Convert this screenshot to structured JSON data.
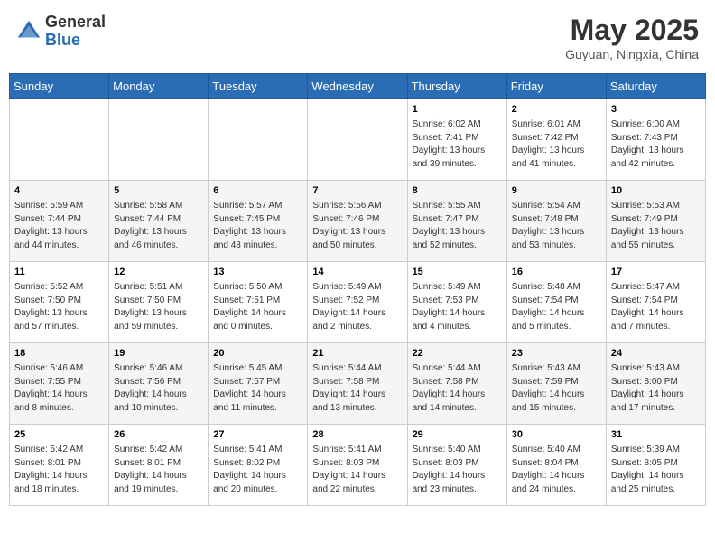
{
  "header": {
    "logo_general": "General",
    "logo_blue": "Blue",
    "title": "May 2025",
    "location": "Guyuan, Ningxia, China"
  },
  "days_of_week": [
    "Sunday",
    "Monday",
    "Tuesday",
    "Wednesday",
    "Thursday",
    "Friday",
    "Saturday"
  ],
  "weeks": [
    {
      "row": 1,
      "days": [
        {
          "num": "",
          "info": ""
        },
        {
          "num": "",
          "info": ""
        },
        {
          "num": "",
          "info": ""
        },
        {
          "num": "",
          "info": ""
        },
        {
          "num": "1",
          "info": "Sunrise: 6:02 AM\nSunset: 7:41 PM\nDaylight: 13 hours and 39 minutes."
        },
        {
          "num": "2",
          "info": "Sunrise: 6:01 AM\nSunset: 7:42 PM\nDaylight: 13 hours and 41 minutes."
        },
        {
          "num": "3",
          "info": "Sunrise: 6:00 AM\nSunset: 7:43 PM\nDaylight: 13 hours and 42 minutes."
        }
      ]
    },
    {
      "row": 2,
      "days": [
        {
          "num": "4",
          "info": "Sunrise: 5:59 AM\nSunset: 7:44 PM\nDaylight: 13 hours and 44 minutes."
        },
        {
          "num": "5",
          "info": "Sunrise: 5:58 AM\nSunset: 7:44 PM\nDaylight: 13 hours and 46 minutes."
        },
        {
          "num": "6",
          "info": "Sunrise: 5:57 AM\nSunset: 7:45 PM\nDaylight: 13 hours and 48 minutes."
        },
        {
          "num": "7",
          "info": "Sunrise: 5:56 AM\nSunset: 7:46 PM\nDaylight: 13 hours and 50 minutes."
        },
        {
          "num": "8",
          "info": "Sunrise: 5:55 AM\nSunset: 7:47 PM\nDaylight: 13 hours and 52 minutes."
        },
        {
          "num": "9",
          "info": "Sunrise: 5:54 AM\nSunset: 7:48 PM\nDaylight: 13 hours and 53 minutes."
        },
        {
          "num": "10",
          "info": "Sunrise: 5:53 AM\nSunset: 7:49 PM\nDaylight: 13 hours and 55 minutes."
        }
      ]
    },
    {
      "row": 3,
      "days": [
        {
          "num": "11",
          "info": "Sunrise: 5:52 AM\nSunset: 7:50 PM\nDaylight: 13 hours and 57 minutes."
        },
        {
          "num": "12",
          "info": "Sunrise: 5:51 AM\nSunset: 7:50 PM\nDaylight: 13 hours and 59 minutes."
        },
        {
          "num": "13",
          "info": "Sunrise: 5:50 AM\nSunset: 7:51 PM\nDaylight: 14 hours and 0 minutes."
        },
        {
          "num": "14",
          "info": "Sunrise: 5:49 AM\nSunset: 7:52 PM\nDaylight: 14 hours and 2 minutes."
        },
        {
          "num": "15",
          "info": "Sunrise: 5:49 AM\nSunset: 7:53 PM\nDaylight: 14 hours and 4 minutes."
        },
        {
          "num": "16",
          "info": "Sunrise: 5:48 AM\nSunset: 7:54 PM\nDaylight: 14 hours and 5 minutes."
        },
        {
          "num": "17",
          "info": "Sunrise: 5:47 AM\nSunset: 7:54 PM\nDaylight: 14 hours and 7 minutes."
        }
      ]
    },
    {
      "row": 4,
      "days": [
        {
          "num": "18",
          "info": "Sunrise: 5:46 AM\nSunset: 7:55 PM\nDaylight: 14 hours and 8 minutes."
        },
        {
          "num": "19",
          "info": "Sunrise: 5:46 AM\nSunset: 7:56 PM\nDaylight: 14 hours and 10 minutes."
        },
        {
          "num": "20",
          "info": "Sunrise: 5:45 AM\nSunset: 7:57 PM\nDaylight: 14 hours and 11 minutes."
        },
        {
          "num": "21",
          "info": "Sunrise: 5:44 AM\nSunset: 7:58 PM\nDaylight: 14 hours and 13 minutes."
        },
        {
          "num": "22",
          "info": "Sunrise: 5:44 AM\nSunset: 7:58 PM\nDaylight: 14 hours and 14 minutes."
        },
        {
          "num": "23",
          "info": "Sunrise: 5:43 AM\nSunset: 7:59 PM\nDaylight: 14 hours and 15 minutes."
        },
        {
          "num": "24",
          "info": "Sunrise: 5:43 AM\nSunset: 8:00 PM\nDaylight: 14 hours and 17 minutes."
        }
      ]
    },
    {
      "row": 5,
      "days": [
        {
          "num": "25",
          "info": "Sunrise: 5:42 AM\nSunset: 8:01 PM\nDaylight: 14 hours and 18 minutes."
        },
        {
          "num": "26",
          "info": "Sunrise: 5:42 AM\nSunset: 8:01 PM\nDaylight: 14 hours and 19 minutes."
        },
        {
          "num": "27",
          "info": "Sunrise: 5:41 AM\nSunset: 8:02 PM\nDaylight: 14 hours and 20 minutes."
        },
        {
          "num": "28",
          "info": "Sunrise: 5:41 AM\nSunset: 8:03 PM\nDaylight: 14 hours and 22 minutes."
        },
        {
          "num": "29",
          "info": "Sunrise: 5:40 AM\nSunset: 8:03 PM\nDaylight: 14 hours and 23 minutes."
        },
        {
          "num": "30",
          "info": "Sunrise: 5:40 AM\nSunset: 8:04 PM\nDaylight: 14 hours and 24 minutes."
        },
        {
          "num": "31",
          "info": "Sunrise: 5:39 AM\nSunset: 8:05 PM\nDaylight: 14 hours and 25 minutes."
        }
      ]
    }
  ]
}
